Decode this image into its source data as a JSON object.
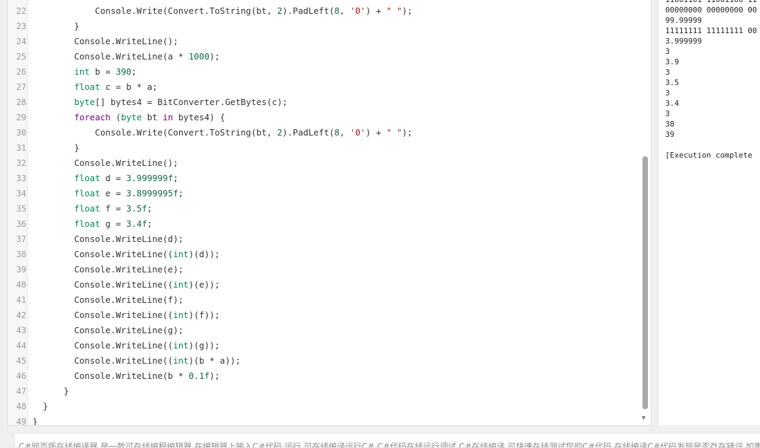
{
  "editor": {
    "lines": [
      {
        "n": "22",
        "tokens": [
          {
            "t": "            Console.Write(Convert.ToString(bt, ",
            "c": ""
          },
          {
            "t": "2",
            "c": "num"
          },
          {
            "t": ").PadLeft(",
            "c": ""
          },
          {
            "t": "8",
            "c": "num"
          },
          {
            "t": ", ",
            "c": ""
          },
          {
            "t": "'0'",
            "c": "str"
          },
          {
            "t": ") + ",
            "c": ""
          },
          {
            "t": "\" \"",
            "c": "str"
          },
          {
            "t": ");",
            "c": ""
          }
        ]
      },
      {
        "n": "23",
        "tokens": [
          {
            "t": "        }",
            "c": ""
          }
        ]
      },
      {
        "n": "24",
        "tokens": [
          {
            "t": "        Console.WriteLine();",
            "c": ""
          }
        ]
      },
      {
        "n": "25",
        "tokens": [
          {
            "t": "        Console.WriteLine(a * ",
            "c": ""
          },
          {
            "t": "1000",
            "c": "num"
          },
          {
            "t": ");",
            "c": ""
          }
        ]
      },
      {
        "n": "26",
        "tokens": [
          {
            "t": "        ",
            "c": ""
          },
          {
            "t": "int",
            "c": "ty"
          },
          {
            "t": " b = ",
            "c": ""
          },
          {
            "t": "390",
            "c": "num"
          },
          {
            "t": ";",
            "c": ""
          }
        ]
      },
      {
        "n": "27",
        "tokens": [
          {
            "t": "        ",
            "c": ""
          },
          {
            "t": "float",
            "c": "ty"
          },
          {
            "t": " c = b * a;",
            "c": ""
          }
        ]
      },
      {
        "n": "28",
        "tokens": [
          {
            "t": "        ",
            "c": ""
          },
          {
            "t": "byte",
            "c": "ty"
          },
          {
            "t": "[] bytes4 = BitConverter.GetBytes(c);",
            "c": ""
          }
        ]
      },
      {
        "n": "29",
        "tokens": [
          {
            "t": "        ",
            "c": ""
          },
          {
            "t": "foreach",
            "c": "kw"
          },
          {
            "t": " (",
            "c": ""
          },
          {
            "t": "byte",
            "c": "ty"
          },
          {
            "t": " bt ",
            "c": ""
          },
          {
            "t": "in",
            "c": "kw"
          },
          {
            "t": " bytes4) {",
            "c": ""
          }
        ]
      },
      {
        "n": "30",
        "tokens": [
          {
            "t": "            Console.Write(Convert.ToString(bt, ",
            "c": ""
          },
          {
            "t": "2",
            "c": "num"
          },
          {
            "t": ").PadLeft(",
            "c": ""
          },
          {
            "t": "8",
            "c": "num"
          },
          {
            "t": ", ",
            "c": ""
          },
          {
            "t": "'0'",
            "c": "str"
          },
          {
            "t": ") + ",
            "c": ""
          },
          {
            "t": "\" \"",
            "c": "str"
          },
          {
            "t": ");",
            "c": ""
          }
        ]
      },
      {
        "n": "31",
        "tokens": [
          {
            "t": "        }",
            "c": ""
          }
        ]
      },
      {
        "n": "32",
        "tokens": [
          {
            "t": "        Console.WriteLine();",
            "c": ""
          }
        ]
      },
      {
        "n": "33",
        "tokens": [
          {
            "t": "        ",
            "c": ""
          },
          {
            "t": "float",
            "c": "ty"
          },
          {
            "t": " d = ",
            "c": ""
          },
          {
            "t": "3.999999f",
            "c": "num"
          },
          {
            "t": ";",
            "c": ""
          }
        ]
      },
      {
        "n": "34",
        "tokens": [
          {
            "t": "        ",
            "c": ""
          },
          {
            "t": "float",
            "c": "ty"
          },
          {
            "t": " e = ",
            "c": ""
          },
          {
            "t": "3.8999995f",
            "c": "num"
          },
          {
            "t": ";",
            "c": ""
          }
        ]
      },
      {
        "n": "35",
        "tokens": [
          {
            "t": "        ",
            "c": ""
          },
          {
            "t": "float",
            "c": "ty"
          },
          {
            "t": " f = ",
            "c": ""
          },
          {
            "t": "3.5f",
            "c": "num"
          },
          {
            "t": ";",
            "c": ""
          }
        ]
      },
      {
        "n": "36",
        "tokens": [
          {
            "t": "        ",
            "c": ""
          },
          {
            "t": "float",
            "c": "ty"
          },
          {
            "t": " g = ",
            "c": ""
          },
          {
            "t": "3.4f",
            "c": "num"
          },
          {
            "t": ";",
            "c": ""
          }
        ]
      },
      {
        "n": "37",
        "tokens": [
          {
            "t": "        Console.WriteLine(d);",
            "c": ""
          }
        ]
      },
      {
        "n": "38",
        "tokens": [
          {
            "t": "        Console.WriteLine((",
            "c": ""
          },
          {
            "t": "int",
            "c": "ty"
          },
          {
            "t": ")(d));",
            "c": ""
          }
        ]
      },
      {
        "n": "39",
        "tokens": [
          {
            "t": "        Console.WriteLine(e);",
            "c": ""
          }
        ]
      },
      {
        "n": "40",
        "tokens": [
          {
            "t": "        Console.WriteLine((",
            "c": ""
          },
          {
            "t": "int",
            "c": "ty"
          },
          {
            "t": ")(e));",
            "c": ""
          }
        ]
      },
      {
        "n": "41",
        "tokens": [
          {
            "t": "        Console.WriteLine(f);",
            "c": ""
          }
        ]
      },
      {
        "n": "42",
        "tokens": [
          {
            "t": "        Console.WriteLine((",
            "c": ""
          },
          {
            "t": "int",
            "c": "ty"
          },
          {
            "t": ")(f));",
            "c": ""
          }
        ]
      },
      {
        "n": "43",
        "tokens": [
          {
            "t": "        Console.WriteLine(g);",
            "c": ""
          }
        ]
      },
      {
        "n": "44",
        "tokens": [
          {
            "t": "        Console.WriteLine((",
            "c": ""
          },
          {
            "t": "int",
            "c": "ty"
          },
          {
            "t": ")(g));",
            "c": ""
          }
        ]
      },
      {
        "n": "45",
        "tokens": [
          {
            "t": "        Console.WriteLine((",
            "c": ""
          },
          {
            "t": "int",
            "c": "ty"
          },
          {
            "t": ")(b * a));",
            "c": ""
          }
        ]
      },
      {
        "n": "46",
        "tokens": [
          {
            "t": "        Console.WriteLine(b * ",
            "c": ""
          },
          {
            "t": "0.1f",
            "c": "num"
          },
          {
            "t": ");",
            "c": ""
          }
        ]
      },
      {
        "n": "47",
        "tokens": [
          {
            "t": "      }",
            "c": ""
          }
        ]
      },
      {
        "n": "48",
        "tokens": [
          {
            "t": "  }",
            "c": ""
          }
        ]
      },
      {
        "n": "49",
        "tokens": [
          {
            "t": "}",
            "c": ""
          }
        ]
      }
    ],
    "scroll_down_glyph": "▼"
  },
  "output": {
    "lines": [
      "11001101 11001100 11",
      "00000000 00000000 00",
      "99.99999",
      "11111111 11111111 00",
      "3.999999",
      "3",
      "3.9",
      "3",
      "3.5",
      "3",
      "3.4",
      "3",
      "38",
      "39",
      "",
      "[Execution complete"
    ]
  },
  "footer": {
    "text": "C#网页版在线编译器,是一款可在线编程编辑器,在编辑器上输入C#代码,运行,可在线编译运行C#,C#代码在线运行调试,C#在线编译,可快速在线测试您的C#代码,在线编译C#代码发现是否存在错误,如果代码"
  },
  "colors": {
    "keyword": "#770088",
    "type": "#008855",
    "number": "#116644",
    "string": "#aa1111",
    "line_number": "#999999"
  }
}
